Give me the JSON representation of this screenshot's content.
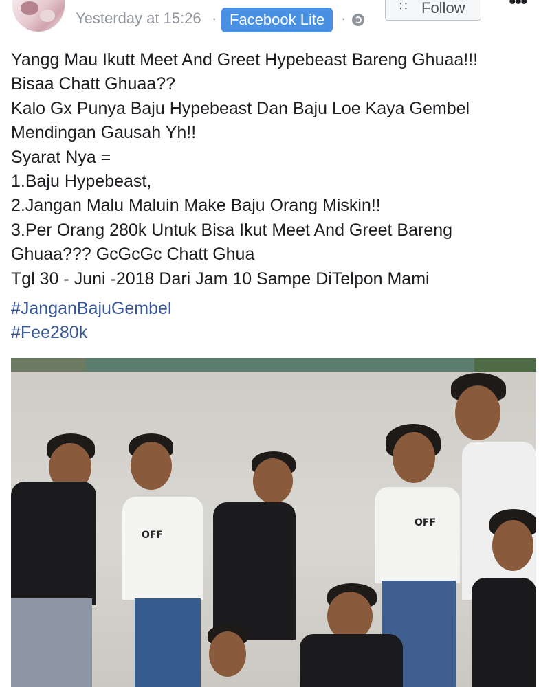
{
  "post": {
    "timestamp": "Yesterday at 15:26",
    "separator": "·",
    "app_badge": "Facebook Lite",
    "follow_label": "Follow",
    "more_label": "•••",
    "lines": [
      "Yangg Mau Ikutt Meet And Greet Hypebeast Bareng Ghuaa!!!",
      "Bisaa Chatt Ghuaa??",
      "Kalo Gx Punya Baju Hypebeast Dan Baju Loe Kaya Gembel",
      "Mendingan Gausah Yh!!",
      "Syarat Nya =",
      "1.Baju Hypebeast,",
      "2.Jangan Malu Maluin Make Baju Orang Miskin!!",
      "3.Per Orang 280k Untuk Bisa Ikut Meet And Greet Bareng",
      "Ghuaa??? GcGcGc Chatt Ghua",
      "Tgl 30 - Juni -2018 Dari Jam 10 Sampe DiTelpon Mami"
    ],
    "hashtags": [
      "#JanganBajuGembel",
      "#Fee280k"
    ]
  },
  "photo": {
    "shirt_labels": [
      "OFF",
      "OFF"
    ]
  },
  "colors": {
    "badge": "#4a90e2",
    "hashtag": "#385898",
    "meta_gray": "#90949c"
  }
}
